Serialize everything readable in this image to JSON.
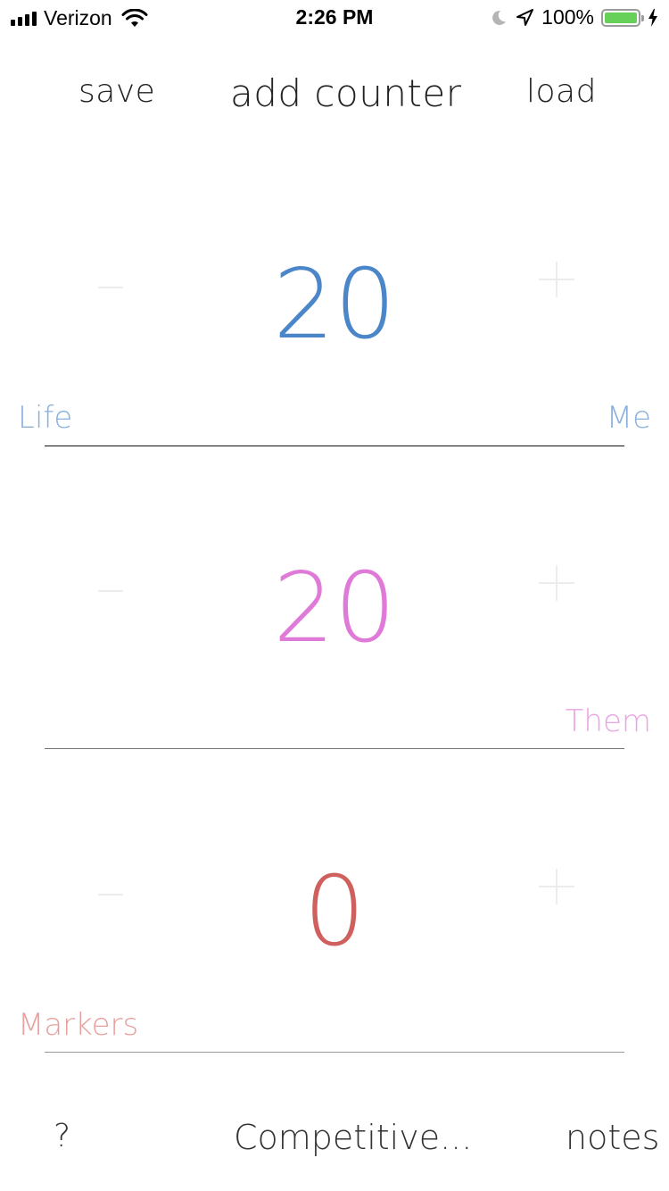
{
  "status_bar": {
    "carrier": "Verizon",
    "time": "2:26 PM",
    "battery_percent": "100%",
    "battery_level": 1.0,
    "icons": [
      "signal-icon",
      "wifi-icon",
      "moon-icon",
      "location-arrow-icon",
      "battery-icon",
      "charging-bolt-icon"
    ]
  },
  "top_bar": {
    "save_label": "save",
    "add_counter_label": "add counter",
    "load_label": "load"
  },
  "counters": [
    {
      "value": "20",
      "left_label": "Life",
      "right_label": "Me",
      "color": "#4a86c8"
    },
    {
      "value": "20",
      "left_label": "",
      "right_label": "Them",
      "color": "#e07ad8"
    },
    {
      "value": "0",
      "left_label": "Markers",
      "right_label": "",
      "color": "#d0605e"
    }
  ],
  "label_colors": {
    "life": "#8ab0dc",
    "me": "#8ab0dc",
    "them": "#e9a4e4",
    "markers": "#e8a09e"
  },
  "bottom_bar": {
    "help_label": "?",
    "mode_label": "Competitive...",
    "notes_label": "notes"
  }
}
